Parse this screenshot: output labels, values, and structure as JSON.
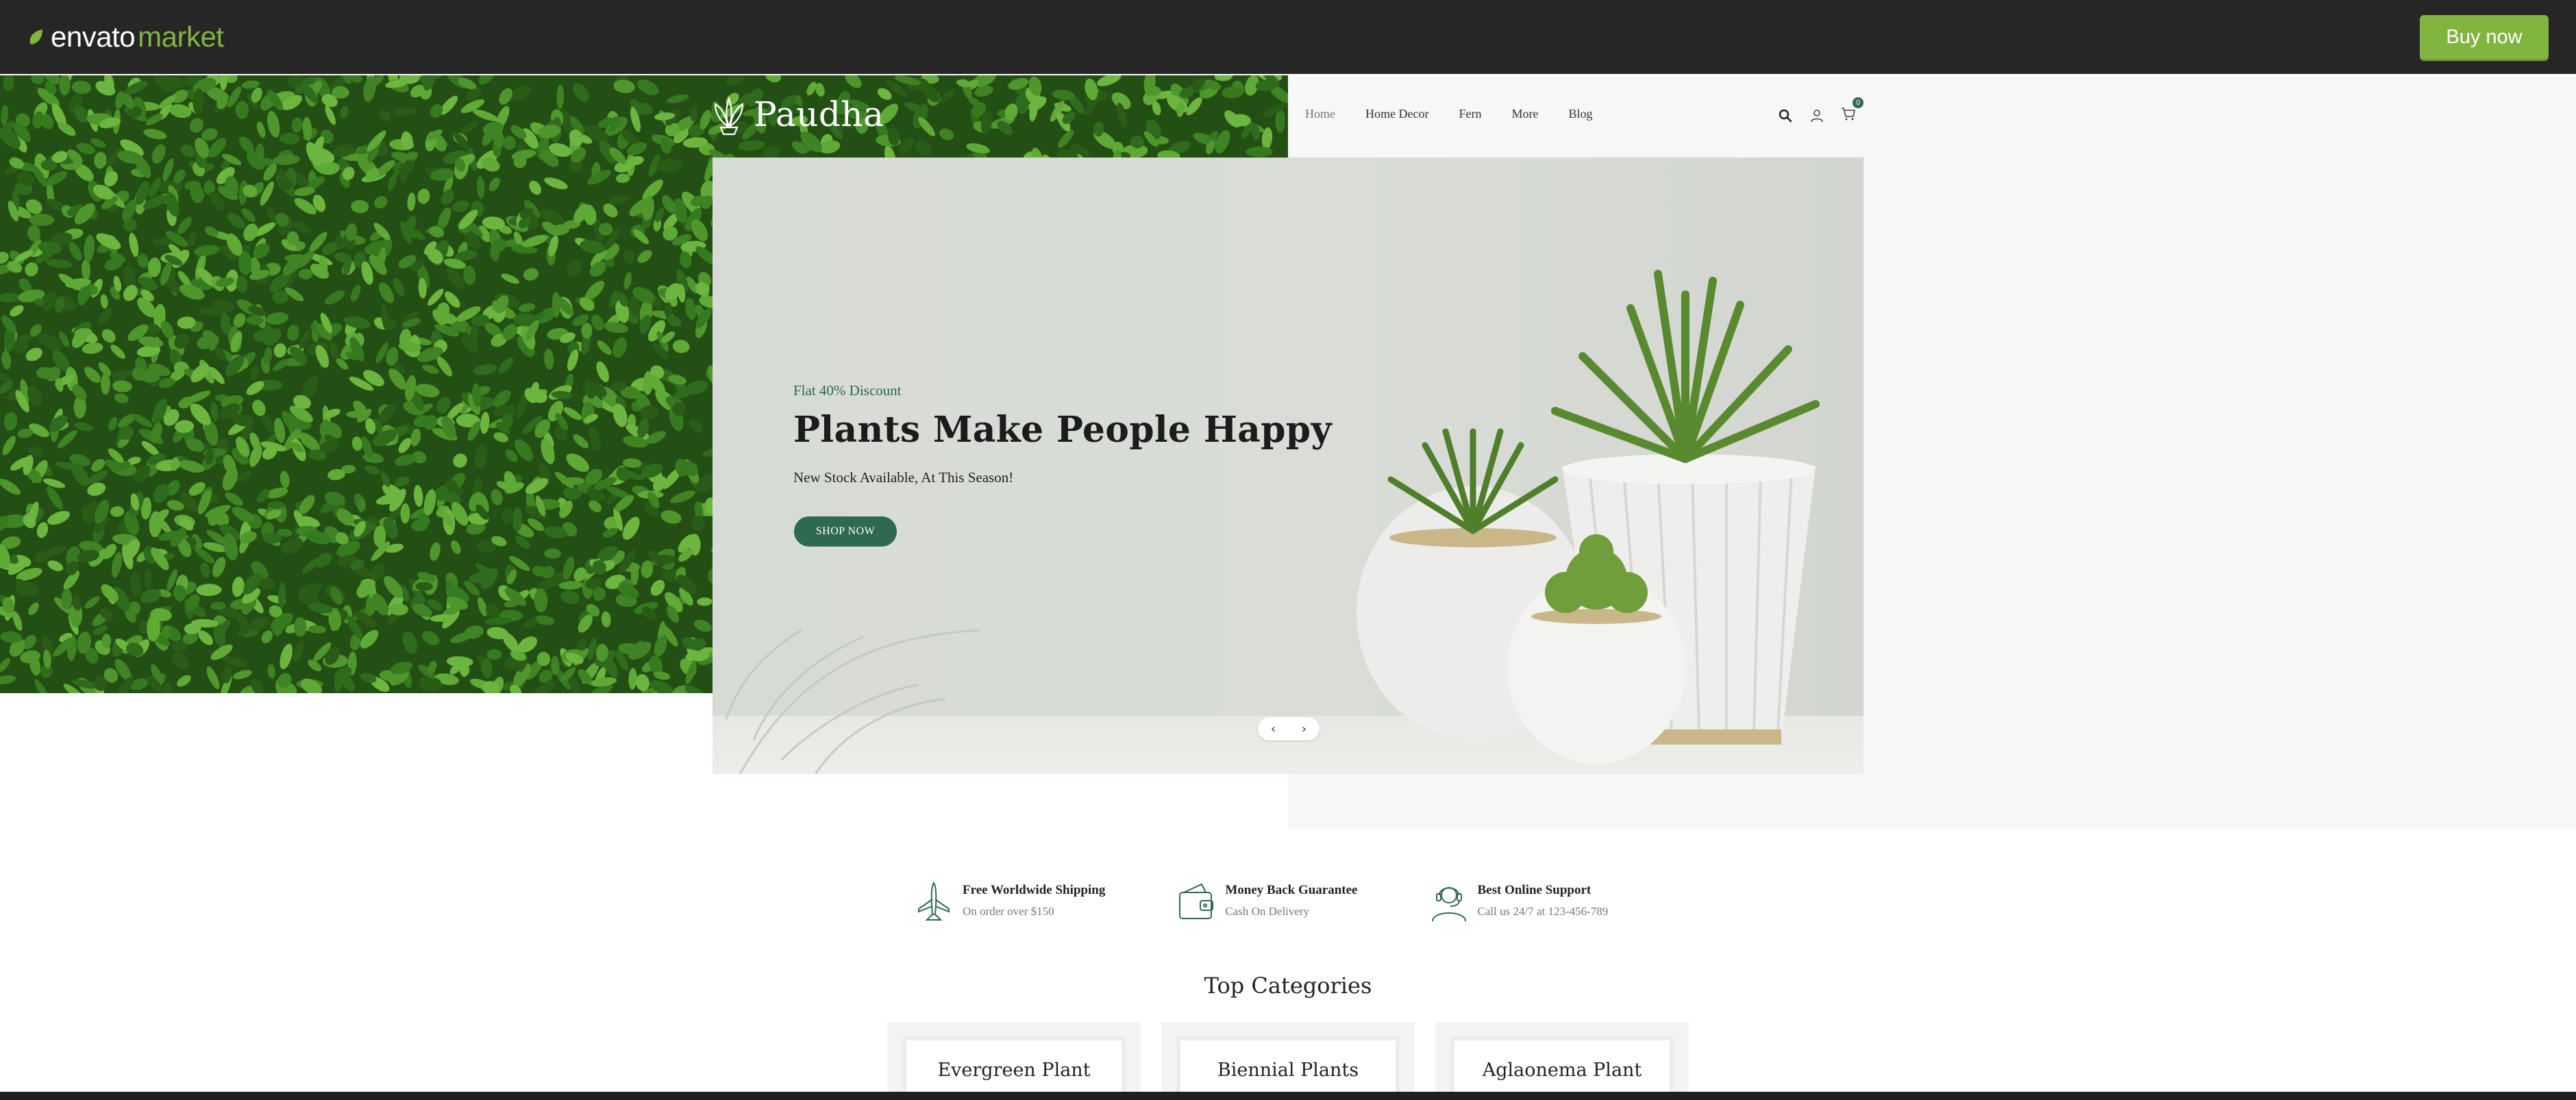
{
  "envato": {
    "logo_word": "envato",
    "logo_market": "market",
    "buy_now": "Buy now"
  },
  "site": {
    "logo": "Paudha",
    "nav": [
      "Home",
      "Home Decor",
      "Fern",
      "More",
      "Blog"
    ],
    "cart_count": "0"
  },
  "hero": {
    "tag": "Flat 40% Discount",
    "title": "Plants Make People Happy",
    "subtitle": "New Stock Available, At This Season!",
    "cta": "SHOP NOW",
    "prev": "‹",
    "next": "›"
  },
  "features": [
    {
      "icon": "plane-icon",
      "title": "Free Worldwide Shipping",
      "desc": "On order over $150"
    },
    {
      "icon": "wallet-icon",
      "title": "Money Back Guarantee",
      "desc": "Cash On Delivery"
    },
    {
      "icon": "support-agent-icon",
      "title": "Best Online Support",
      "desc": "Call us 24/7 at 123-456-789"
    }
  ],
  "categories": {
    "title": "Top Categories",
    "items": [
      "Evergreen Plant",
      "Biennial Plants",
      "Aglaonema Plant"
    ]
  },
  "colors": {
    "envato_bar": "#262626",
    "envato_green": "#82b440",
    "brand_green": "#2d6a4f"
  }
}
